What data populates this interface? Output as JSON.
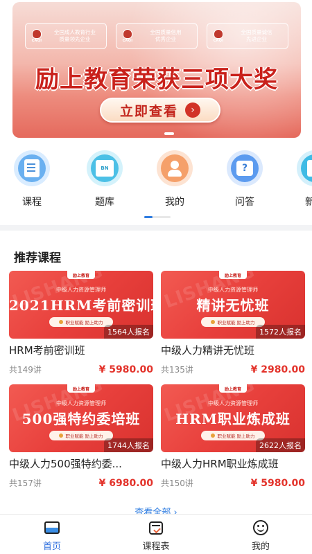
{
  "banner": {
    "awards": [
      "全国成人教育行业\n质量领先企业",
      "全国质量信用\n优秀企业",
      "全国质量诚信\n先进企业"
    ],
    "award_logo_text": "CAQI",
    "title": "励上教育荣获三项大奖",
    "button_label": "立即查看",
    "button_arrow": "›"
  },
  "categories": [
    {
      "label": "课程",
      "icon": "course-doc-icon",
      "color": "#4a90d9"
    },
    {
      "label": "题库",
      "icon": "question-bank-icon",
      "color": "#2a9ec9"
    },
    {
      "label": "我的",
      "icon": "user-icon",
      "color": "#ef8c52"
    },
    {
      "label": "问答",
      "icon": "qa-icon",
      "color": "#3b7fd6"
    },
    {
      "label": "新闻",
      "icon": "news-icon",
      "color": "#2aa7d6"
    }
  ],
  "ic_book_text": "BN",
  "ic_qa_text": "?",
  "recommend": {
    "title": "推荐课程",
    "courses": [
      {
        "thumb_sub": "中级人力资源管理师",
        "thumb_title": "2021HRM考前密训班",
        "enrolled": "1564人报名",
        "name": "HRM考前密训班",
        "lessons": "共149讲",
        "price": "¥ 5980.00"
      },
      {
        "thumb_sub": "中级人力资源管理师",
        "thumb_title": "精讲无忧班",
        "enrolled": "1572人报名",
        "name": "中级人力精讲无忧班",
        "lessons": "共135讲",
        "price": "¥ 2980.00"
      },
      {
        "thumb_sub": "中级人力资源管理师",
        "thumb_title": "500强特约委培班",
        "enrolled": "1744人报名",
        "name": "中级人力500强特约委...",
        "lessons": "共157讲",
        "price": "¥ 6980.00"
      },
      {
        "thumb_sub": "中级人力资源管理师",
        "thumb_title": "HRM职业炼成班",
        "enrolled": "2622人报名",
        "name": "中级人力HRM职业炼成班",
        "lessons": "共150讲",
        "price": "¥ 5980.00"
      }
    ],
    "thumb_logo": "励上教育",
    "thumb_pill": "职业赋能 励上助力",
    "thumb_watermark": "LISHANG",
    "view_all": "查看全部 ›"
  },
  "tabbar": {
    "tabs": [
      {
        "label": "首页",
        "icon": "home-icon",
        "active": true
      },
      {
        "label": "课程表",
        "icon": "schedule-icon",
        "active": false
      },
      {
        "label": "我的",
        "icon": "smile-icon",
        "active": false
      }
    ]
  },
  "colors": {
    "accent": "#2f7de1",
    "price": "#e3332b",
    "card_red": "#e8403c"
  }
}
